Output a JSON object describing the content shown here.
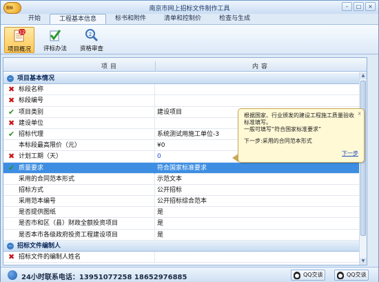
{
  "window": {
    "title": "南京市网上招标文件制作工具",
    "logo_text": "招标"
  },
  "window_buttons": {
    "minimize": "–",
    "maximize": "□",
    "close": "×"
  },
  "tabs": [
    {
      "label": "开始"
    },
    {
      "label": "工程基本信息",
      "active": true
    },
    {
      "label": "标书和附件"
    },
    {
      "label": "清单和控制价"
    },
    {
      "label": "检查与生成"
    }
  ],
  "ribbon": {
    "items": [
      {
        "label": "项目概况",
        "badge": "12",
        "icon": "document-list-icon",
        "active": true
      },
      {
        "label": "评标办法",
        "icon": "checkmark-icon"
      },
      {
        "label": "资格审查",
        "badge": "2",
        "icon": "magnifier-icon"
      }
    ]
  },
  "table": {
    "header": {
      "col1": "项目",
      "col2": "内容"
    },
    "rows": [
      {
        "type": "section",
        "label": "项目基本情况"
      },
      {
        "status": "x",
        "label": "标段名称",
        "value": ""
      },
      {
        "status": "x",
        "label": "标段编号",
        "value": ""
      },
      {
        "status": "ok",
        "label": "项目类别",
        "value": "建设项目"
      },
      {
        "status": "x",
        "label": "建设单位",
        "value": ""
      },
      {
        "status": "ok",
        "label": "招标代理",
        "value": "系统测试用施工单位-3"
      },
      {
        "status": "",
        "label": "本标段最高限价（元）",
        "value": "¥0"
      },
      {
        "status": "x",
        "label": "计划工期（天）",
        "value": "0",
        "value_blue": true
      },
      {
        "status": "ok",
        "label": "质量要求",
        "value": "符合国家标准要求",
        "selected": true
      },
      {
        "status": "",
        "label": "采用的合同范本形式",
        "value": "示范文本"
      },
      {
        "status": "",
        "label": "招标方式",
        "value": "公开招标"
      },
      {
        "status": "",
        "label": "采用范本编号",
        "value": "公开招标综合范本"
      },
      {
        "status": "",
        "label": "是否提供图纸",
        "value": "是"
      },
      {
        "status": "",
        "label": "是否市和区（县）财政全额投资项目",
        "value": "是"
      },
      {
        "status": "",
        "label": "是否本市各级政府投资工程建设项目",
        "value": "是"
      },
      {
        "type": "section",
        "label": "招标文件编制人"
      },
      {
        "status": "x",
        "label": "招标文件的编制人姓名",
        "value": ""
      }
    ]
  },
  "tooltip": {
    "close": "x",
    "lines": [
      "根据国家、行业颁发的建设工程施工质量验收",
      "标准填写。",
      "一般可填写“符合国家标准要求”"
    ],
    "next_text": "下一步:采用的合同范本形式",
    "link": "下一步"
  },
  "footer": {
    "phone_text": "24小时联系电话：13951077258 18652976885",
    "qq_buttons": [
      {
        "label": "QQ交谈"
      },
      {
        "label": "QQ交谈"
      }
    ]
  },
  "colors": {
    "selected_row": "#3d8ee2",
    "error_mark": "#c8121a",
    "ok_mark": "#2f8f22",
    "tooltip_bg": "#fff9d6"
  }
}
